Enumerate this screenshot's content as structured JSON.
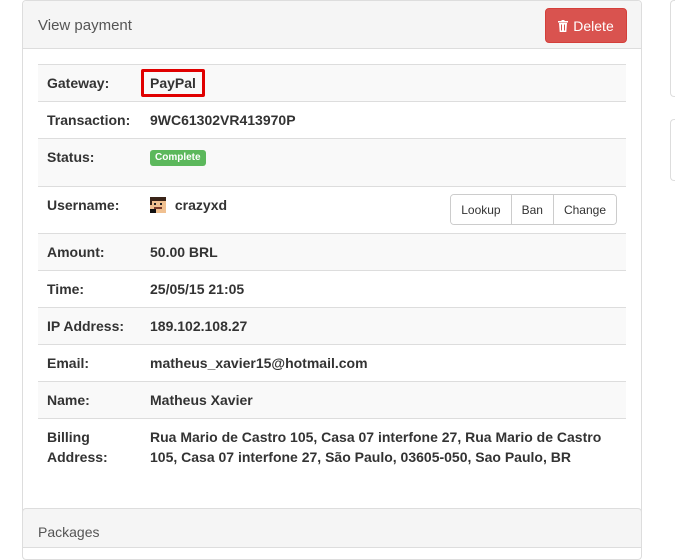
{
  "header": {
    "title": "View payment",
    "delete_label": "Delete",
    "delete_icon": "trash-icon"
  },
  "details": {
    "gateway": {
      "label": "Gateway:",
      "value": "PayPal"
    },
    "transaction": {
      "label": "Transaction:",
      "value": "9WC61302VR413970P"
    },
    "status": {
      "label": "Status:",
      "value": "Complete"
    },
    "username": {
      "label": "Username:",
      "value": "crazyxd",
      "actions": [
        "Lookup",
        "Ban",
        "Change"
      ]
    },
    "amount": {
      "label": "Amount:",
      "value": "50.00 BRL"
    },
    "time": {
      "label": "Time:",
      "value": "25/05/15 21:05"
    },
    "ip": {
      "label": "IP Address:",
      "value": "189.102.108.27"
    },
    "email": {
      "label": "Email:",
      "value": "matheus_xavier15@hotmail.com"
    },
    "name": {
      "label": "Name:",
      "value": "Matheus Xavier"
    },
    "billing": {
      "label_line1": "Billing",
      "label_line2": "Address:",
      "value": "Rua Mario de Castro 105, Casa 07 interfone 27, Rua Mario de Castro 105, Casa 07 interfone 27, São Paulo, 03605-050, Sao Paulo, BR"
    }
  },
  "packages": {
    "title": "Packages"
  },
  "colors": {
    "danger": "#d9534f",
    "success": "#5cb85c",
    "highlight": "#e00000"
  }
}
